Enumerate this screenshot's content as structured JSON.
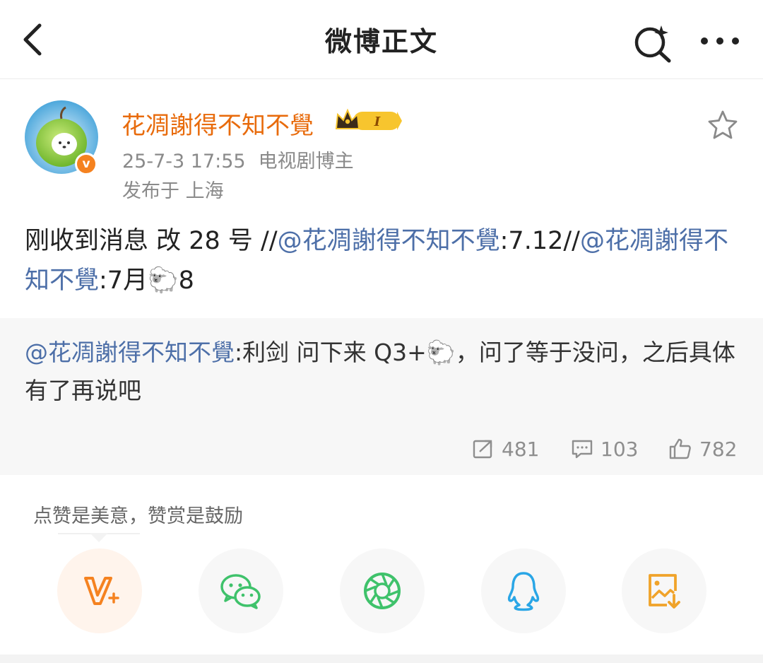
{
  "nav": {
    "title": "微博正文",
    "back_icon": "back-chevron-icon",
    "search_icon": "search-icon",
    "more_icon": "more-dots-icon"
  },
  "post": {
    "username": "花凋謝得不知不覺",
    "member_badge": "I",
    "date": "25-7-3 17:55",
    "source": "电视剧博主",
    "location": "发布于 上海",
    "verified_badge": "v",
    "body": {
      "part1": "刚收到消息 改 28 号 //",
      "mention1": "@花凋謝得不知不覺",
      "part2": ":7.12//",
      "mention2": "@花凋謝得不知不覺",
      "part3": ":7月",
      "emoji": "🐑",
      "part4": "8"
    }
  },
  "repost": {
    "mention": "@花凋謝得不知不覺",
    "part1": ":利剑 问下来 Q3+",
    "emoji": "🐑",
    "part2": "，问了等于没问，之后具体有了再说吧"
  },
  "stats": {
    "reposts": "481",
    "comments": "103",
    "likes": "782"
  },
  "reward": {
    "tip": "点赞是美意，赞赏是鼓励"
  },
  "share": {
    "items": [
      "reward-v-icon",
      "wechat-icon",
      "moments-icon",
      "qq-icon",
      "save-image-icon"
    ]
  },
  "colors": {
    "username": "#e86b0c",
    "mention": "#4d6fa8",
    "meta": "#8a8a8a",
    "repost_bg": "#f7f7f7",
    "wechat": "#3fc26b",
    "moments": "#3fc26b",
    "qq": "#2aa6e6",
    "reward": "#f58220",
    "save": "#f0a32a"
  }
}
